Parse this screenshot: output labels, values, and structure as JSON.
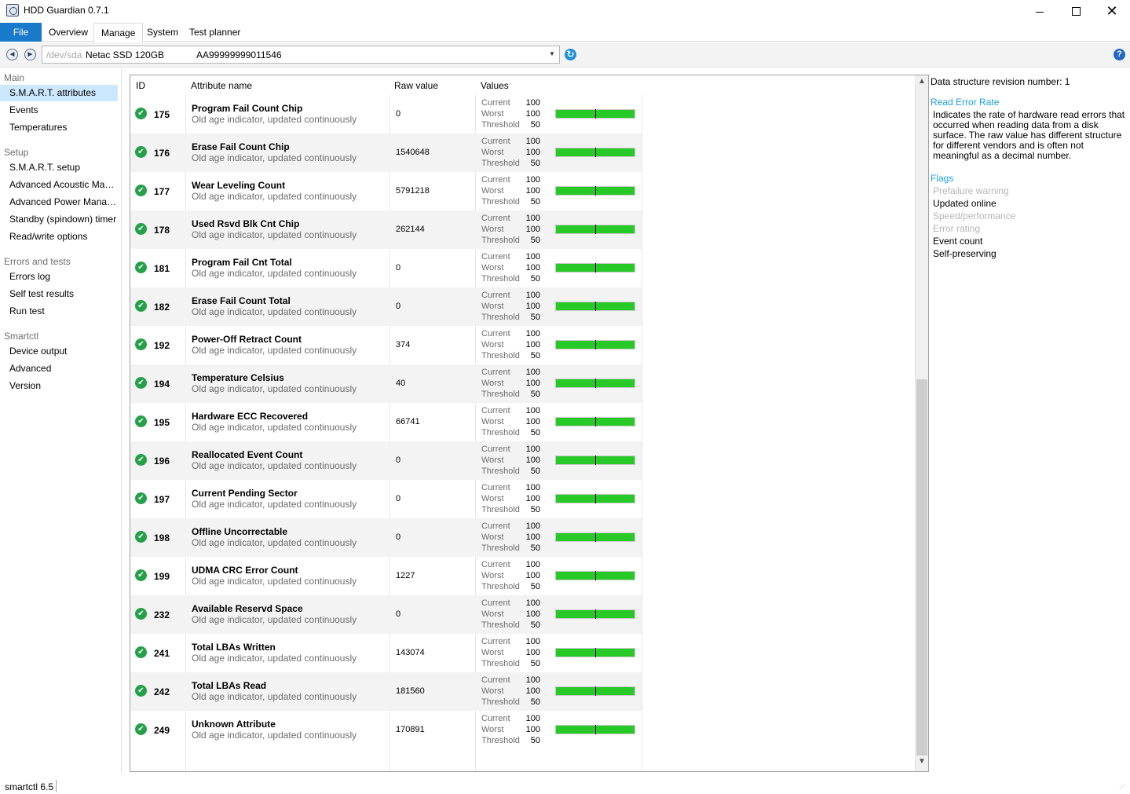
{
  "window": {
    "title": "HDD Guardian 0.7.1",
    "minimize_icon": "minimize-icon",
    "maximize_icon": "maximize-icon",
    "close_label": "✕"
  },
  "ribbon": {
    "tabs": [
      {
        "label": "File",
        "accent": "#1979ca"
      },
      {
        "label": "Overview"
      },
      {
        "label": "Manage",
        "selected": true
      },
      {
        "label": "System"
      },
      {
        "label": "Test planner"
      }
    ]
  },
  "toolbar": {
    "back_icon": "arrow-left-icon",
    "forward_icon": "arrow-right-icon",
    "back_label": "◄",
    "forward_label": "►",
    "device": {
      "path": "/dev/sda",
      "model": "Netac SSD 120GB",
      "serial": "AA99999999011546"
    },
    "dropdown_label": "▼",
    "refresh_label": "↻",
    "help_label": "?"
  },
  "sidebar": {
    "groups": [
      {
        "label": "Main",
        "items": [
          {
            "label": "S.M.A.R.T. attributes",
            "selected": true
          },
          {
            "label": "Events"
          },
          {
            "label": "Temperatures"
          }
        ]
      },
      {
        "label": "Setup",
        "items": [
          {
            "label": "S.M.A.R.T. setup"
          },
          {
            "label": "Advanced Acoustic Management"
          },
          {
            "label": "Advanced Power Management"
          },
          {
            "label": "Standby (spindown) timer"
          },
          {
            "label": "Read/write options"
          }
        ]
      },
      {
        "label": "Errors and tests",
        "items": [
          {
            "label": "Errors log"
          },
          {
            "label": "Self test results"
          },
          {
            "label": "Run test"
          }
        ]
      },
      {
        "label": "Smartctl",
        "items": [
          {
            "label": "Device output"
          },
          {
            "label": "Advanced"
          },
          {
            "label": "Version"
          }
        ]
      }
    ],
    "selected_color": "#cce8ff"
  },
  "table": {
    "headers": {
      "id": "ID",
      "name": "Attribute name",
      "raw": "Raw value",
      "values": "Values"
    },
    "labels": {
      "current": "Current",
      "worst": "Worst",
      "threshold": "Threshold"
    },
    "status_icon": "check-circle-icon",
    "status_label": "✔",
    "status_color": "#24a148",
    "bar_color": "#26c926",
    "rows": [
      {
        "id": "175",
        "name": "Program Fail Count Chip",
        "desc": "Old age indicator, updated continuously",
        "raw": "0",
        "current": 100,
        "worst": 100,
        "threshold": 50
      },
      {
        "id": "176",
        "name": "Erase Fail Count Chip",
        "desc": "Old age indicator, updated continuously",
        "raw": "1540648",
        "current": 100,
        "worst": 100,
        "threshold": 50
      },
      {
        "id": "177",
        "name": "Wear Leveling Count",
        "desc": "Old age indicator, updated continuously",
        "raw": "5791218",
        "current": 100,
        "worst": 100,
        "threshold": 50
      },
      {
        "id": "178",
        "name": "Used Rsvd Blk Cnt Chip",
        "desc": "Old age indicator, updated continuously",
        "raw": "262144",
        "current": 100,
        "worst": 100,
        "threshold": 50
      },
      {
        "id": "181",
        "name": "Program Fail Cnt Total",
        "desc": "Old age indicator, updated continuously",
        "raw": "0",
        "current": 100,
        "worst": 100,
        "threshold": 50
      },
      {
        "id": "182",
        "name": "Erase Fail Count Total",
        "desc": "Old age indicator, updated continuously",
        "raw": "0",
        "current": 100,
        "worst": 100,
        "threshold": 50
      },
      {
        "id": "192",
        "name": "Power-Off Retract Count",
        "desc": "Old age indicator, updated continuously",
        "raw": "374",
        "current": 100,
        "worst": 100,
        "threshold": 50
      },
      {
        "id": "194",
        "name": "Temperature Celsius",
        "desc": "Old age indicator, updated continuously",
        "raw": "40",
        "current": 100,
        "worst": 100,
        "threshold": 50
      },
      {
        "id": "195",
        "name": "Hardware ECC Recovered",
        "desc": "Old age indicator, updated continuously",
        "raw": "66741",
        "current": 100,
        "worst": 100,
        "threshold": 50
      },
      {
        "id": "196",
        "name": "Reallocated Event Count",
        "desc": "Old age indicator, updated continuously",
        "raw": "0",
        "current": 100,
        "worst": 100,
        "threshold": 50
      },
      {
        "id": "197",
        "name": "Current Pending Sector",
        "desc": "Old age indicator, updated continuously",
        "raw": "0",
        "current": 100,
        "worst": 100,
        "threshold": 50
      },
      {
        "id": "198",
        "name": "Offline Uncorrectable",
        "desc": "Old age indicator, updated continuously",
        "raw": "0",
        "current": 100,
        "worst": 100,
        "threshold": 50
      },
      {
        "id": "199",
        "name": "UDMA CRC Error Count",
        "desc": "Old age indicator, updated continuously",
        "raw": "1227",
        "current": 100,
        "worst": 100,
        "threshold": 50
      },
      {
        "id": "232",
        "name": "Available Reservd Space",
        "desc": "Old age indicator, updated continuously",
        "raw": "0",
        "current": 100,
        "worst": 100,
        "threshold": 50
      },
      {
        "id": "241",
        "name": "Total LBAs Written",
        "desc": "Old age indicator, updated continuously",
        "raw": "143074",
        "current": 100,
        "worst": 100,
        "threshold": 50
      },
      {
        "id": "242",
        "name": "Total LBAs Read",
        "desc": "Old age indicator, updated continuously",
        "raw": "181560",
        "current": 100,
        "worst": 100,
        "threshold": 50
      },
      {
        "id": "249",
        "name": "Unknown Attribute",
        "desc": "Old age indicator, updated continuously",
        "raw": "170891",
        "current": 100,
        "worst": 100,
        "threshold": 50
      }
    ],
    "scroll_up_label": "▲",
    "scroll_down_label": "▼"
  },
  "detail": {
    "revision": "Data structure revision number: 1",
    "attribute_title": "Read Error Rate",
    "attribute_description": "Indicates the rate of hardware read errors that occurred when reading data from a disk surface. The raw value has different structure for different vendors and is often not meaningful as a decimal number.",
    "flags_title": "Flags",
    "flags": [
      {
        "label": "Prefailure warning",
        "active": false
      },
      {
        "label": "Updated online",
        "active": true
      },
      {
        "label": "Speed/performance",
        "active": false
      },
      {
        "label": "Error rating",
        "active": false
      },
      {
        "label": "Event count",
        "active": true
      },
      {
        "label": "Self-preserving",
        "active": true
      }
    ],
    "accent": "#1ba1e2"
  },
  "statusbar": {
    "text": "smartctl 6.5",
    "grip_label": "⋰"
  }
}
